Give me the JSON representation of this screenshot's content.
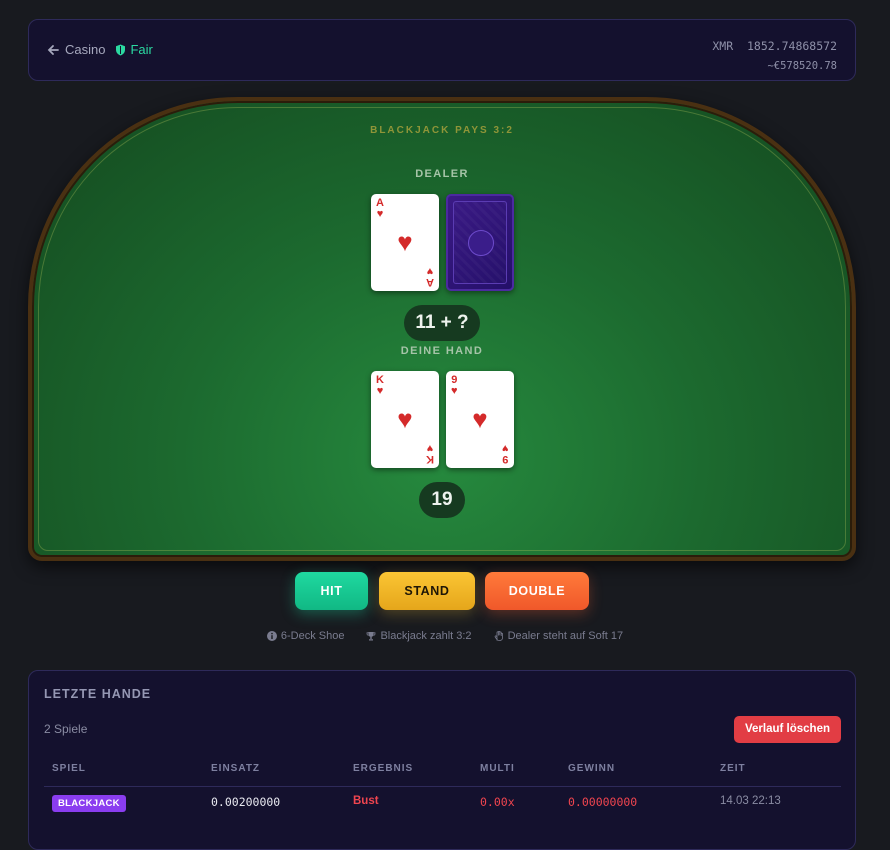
{
  "header": {
    "back_label": "Casino",
    "fair_label": "Fair",
    "balance": "XMR  1852.74868572",
    "balance_fiat": "~€578520.78"
  },
  "table": {
    "pays_text": "BLACKJACK PAYS 3:2",
    "dealer_label": "DEALER",
    "player_label": "DEINE HAND",
    "dealer_score": "11 + ?",
    "player_score": "19",
    "dealer_cards": [
      {
        "rank": "A",
        "suit": "♥",
        "face_up": true
      },
      {
        "face_up": false
      }
    ],
    "player_cards": [
      {
        "rank": "K",
        "suit": "♥"
      },
      {
        "rank": "9",
        "suit": "♥"
      }
    ]
  },
  "actions": {
    "hit": "HIT",
    "stand": "STAND",
    "double": "DOUBLE"
  },
  "rules": {
    "shoe": "6-Deck Shoe",
    "payout": "Blackjack zahlt 3:2",
    "dealer_rule": "Dealer steht auf Soft 17"
  },
  "history": {
    "title": "LETZTE HANDE",
    "count": "2 Spiele",
    "clear_label": "Verlauf löschen",
    "columns": [
      "SPIEL",
      "EINSATZ",
      "ERGEBNIS",
      "MULTI",
      "GEWINN",
      "ZEIT"
    ],
    "rows": [
      {
        "game": "BLACKJACK",
        "bet": "0.00200000",
        "result": "Bust",
        "multi": "0.00x",
        "win": "0.00000000",
        "time": "14.03 22:13"
      }
    ]
  },
  "colors": {
    "felt": "#1f7a36",
    "hit": "#1fd9a0",
    "stand": "#fbc534",
    "double": "#ff7a3a",
    "loss": "#f0454f",
    "badge": "#8a3df0"
  }
}
